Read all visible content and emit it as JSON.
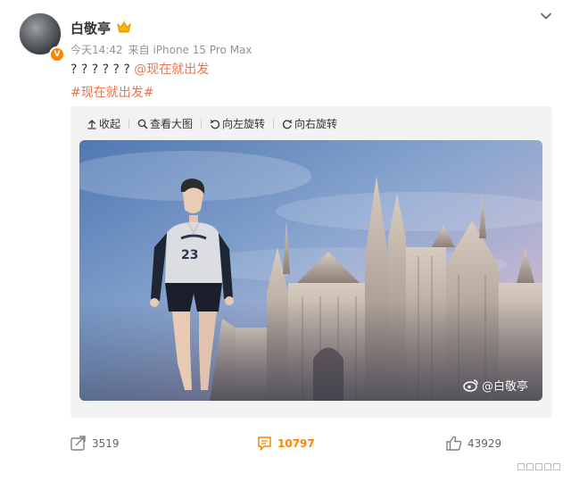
{
  "user": {
    "name": "白敬亭",
    "verified_badge": "V",
    "icon": "crown-icon"
  },
  "meta": {
    "time": "今天14:42",
    "source_prefix": "来自",
    "device": "iPhone 15 Pro Max"
  },
  "post": {
    "text": "? ? ? ? ? ?",
    "mention": "@现在就出发",
    "hashtag": "#现在就出发#"
  },
  "media_toolbar": {
    "collapse": "收起",
    "view_large": "查看大图",
    "rotate_left": "向左旋转",
    "rotate_right": "向右旋转"
  },
  "watermark": "@白敬亭",
  "actions": {
    "repost_count": "3519",
    "comment_count": "10797",
    "like_count": "43929"
  },
  "colors": {
    "accent_orange": "#ff8200",
    "link": "#eb7350"
  }
}
